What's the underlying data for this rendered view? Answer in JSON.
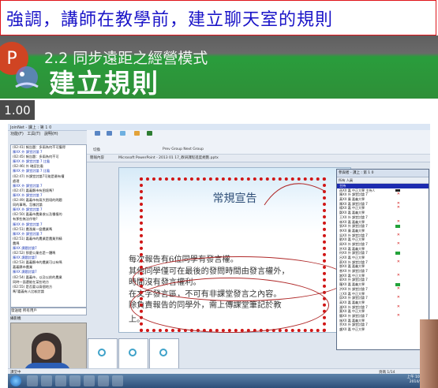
{
  "caption": "強調，講師在教學前，建立聊天室的規則",
  "header": {
    "badge": "P",
    "subtitle": "2.2 同步遠距之經營模式",
    "title": "建立規則",
    "rate": "1.00"
  },
  "slide": {
    "title": "常規宣告",
    "lines": [
      "每次報告有6位同學有發言權。",
      "其他同學僅可在最後的發問時間由發言權外，",
      "時間沒有發言權利。",
      "在文字發言區，不可有非課堂發言之內容。",
      "除負責報告的同學外，需上傳課堂筆記於教"
    ],
    "last": "上。"
  },
  "colors": {
    "caption_border": "#e0141a",
    "caption_text": "#1b15c8",
    "band_green": "#2e8f38",
    "badge": "#d04423",
    "dotted_box": "#d01616"
  },
  "icons": [
    "powerpoint-badge-icon",
    "start-orb-icon"
  ]
}
